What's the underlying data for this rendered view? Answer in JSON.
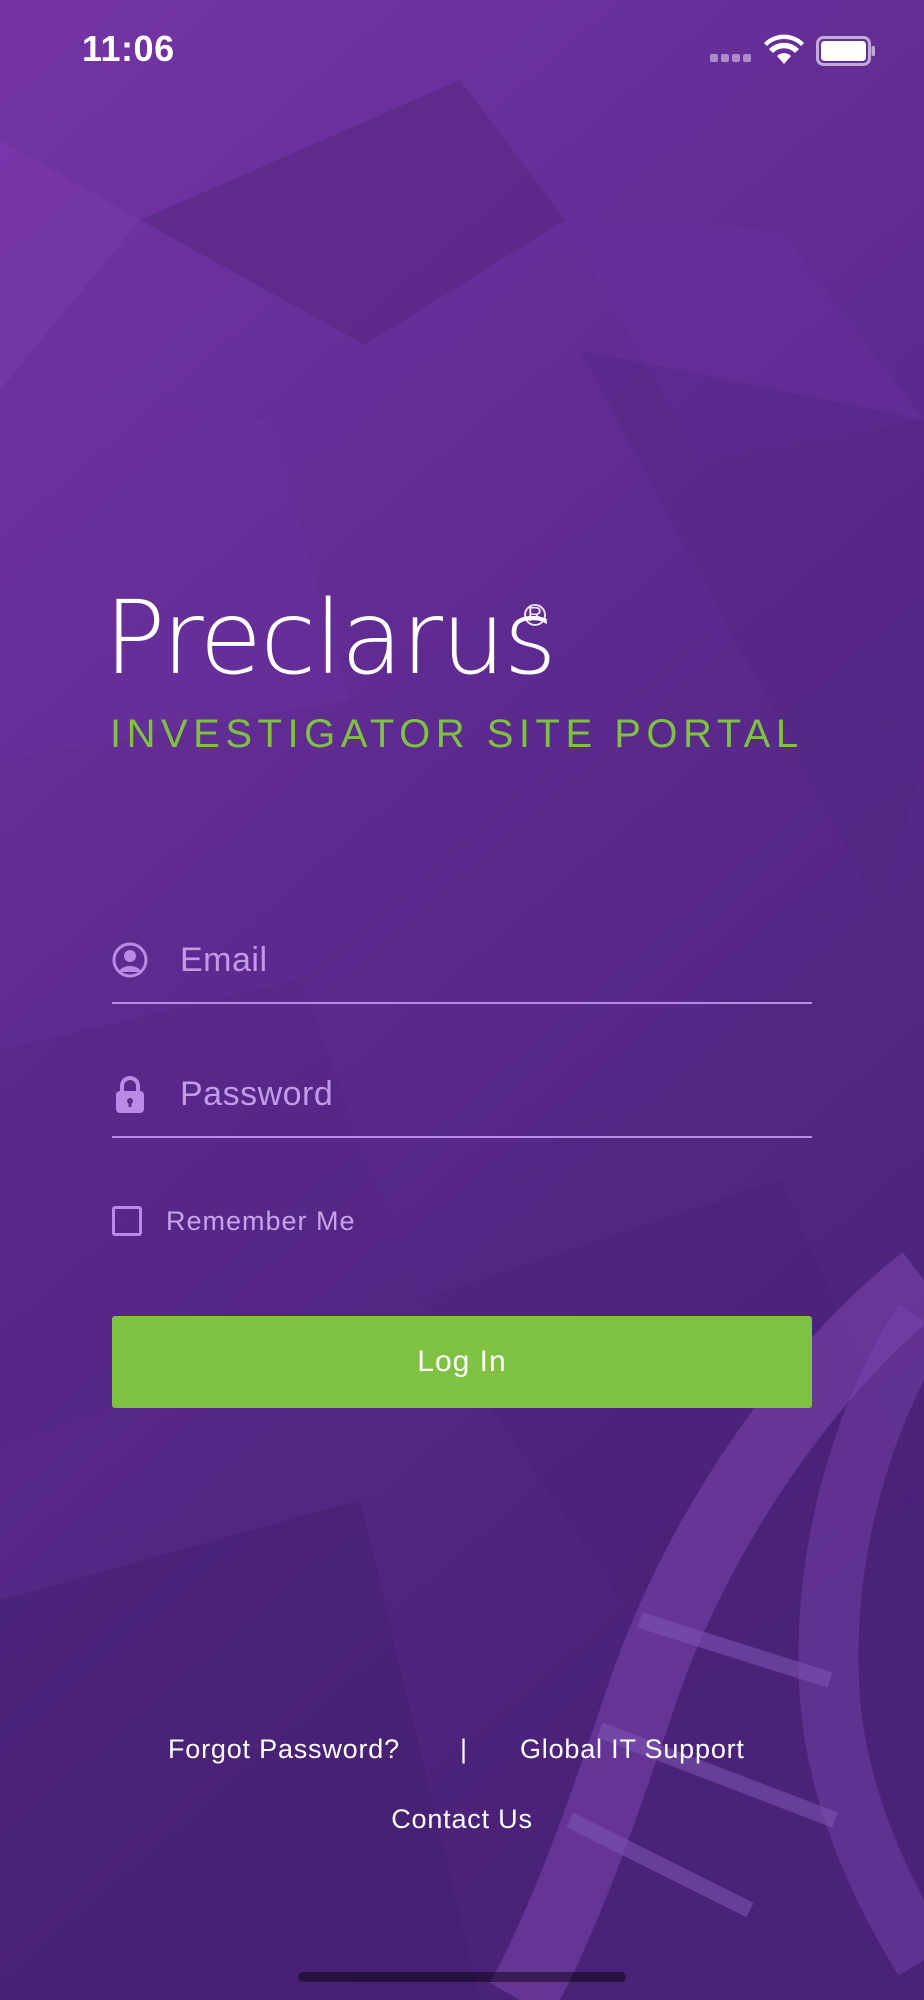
{
  "status_bar": {
    "time": "11:06",
    "signal_icon": "cellular-signal-icon",
    "wifi_icon": "wifi-icon",
    "battery_icon": "battery-icon"
  },
  "brand": {
    "title": "Preclarus",
    "registered_mark": "R",
    "subtitle": "INVESTIGATOR SITE PORTAL"
  },
  "form": {
    "email": {
      "placeholder": "Email",
      "value": "",
      "icon": "user-icon"
    },
    "password": {
      "placeholder": "Password",
      "value": "",
      "icon": "lock-icon"
    },
    "remember_me": {
      "label": "Remember Me",
      "checked": false
    },
    "login_label": "Log In"
  },
  "footer": {
    "forgot_password": "Forgot Password?",
    "separator": "|",
    "global_it_support": "Global IT Support",
    "contact_us": "Contact Us"
  },
  "colors": {
    "background": "#5a2a8e",
    "accent": "#7fc241",
    "field_line": "#b98ae6",
    "placeholder": "#c39ae8"
  }
}
